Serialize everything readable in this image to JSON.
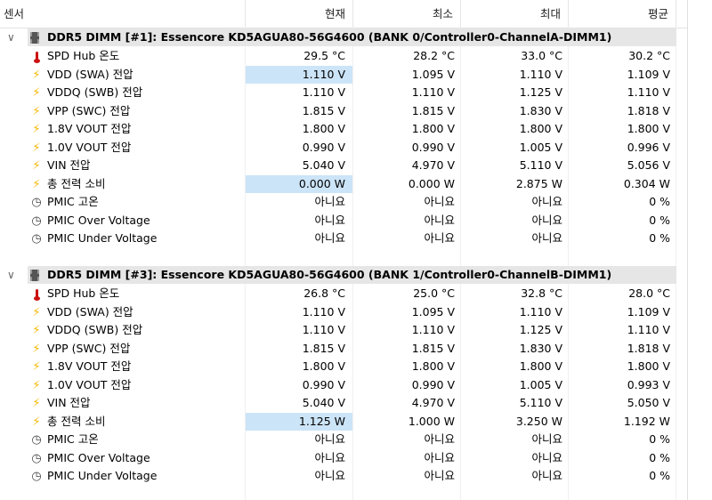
{
  "columns": {
    "sensor": "센서",
    "current": "현재",
    "min": "최소",
    "max": "최대",
    "avg": "평균"
  },
  "groups": [
    {
      "title": "DDR5 DIMM [#1]: Essencore KD5AGUA80-56G4600 (BANK 0/Controller0-ChannelA-DIMM1)",
      "rows": [
        {
          "icon": "thermometer-icon",
          "label": "SPD Hub 온도",
          "cur": "29.5 °C",
          "min": "28.2 °C",
          "max": "33.0 °C",
          "avg": "30.2 °C",
          "hl": false
        },
        {
          "icon": "lightning-icon",
          "label": "VDD (SWA) 전압",
          "cur": "1.110 V",
          "min": "1.095 V",
          "max": "1.110 V",
          "avg": "1.109 V",
          "hl": true
        },
        {
          "icon": "lightning-icon",
          "label": "VDDQ (SWB) 전압",
          "cur": "1.110 V",
          "min": "1.110 V",
          "max": "1.125 V",
          "avg": "1.110 V",
          "hl": false
        },
        {
          "icon": "lightning-icon",
          "label": "VPP (SWC) 전압",
          "cur": "1.815 V",
          "min": "1.815 V",
          "max": "1.830 V",
          "avg": "1.818 V",
          "hl": false
        },
        {
          "icon": "lightning-icon",
          "label": "1.8V VOUT 전압",
          "cur": "1.800 V",
          "min": "1.800 V",
          "max": "1.800 V",
          "avg": "1.800 V",
          "hl": false
        },
        {
          "icon": "lightning-icon",
          "label": "1.0V VOUT 전압",
          "cur": "0.990 V",
          "min": "0.990 V",
          "max": "1.005 V",
          "avg": "0.996 V",
          "hl": false
        },
        {
          "icon": "lightning-icon",
          "label": "VIN 전압",
          "cur": "5.040 V",
          "min": "4.970 V",
          "max": "5.110 V",
          "avg": "5.056 V",
          "hl": false
        },
        {
          "icon": "lightning-icon",
          "label": "총 전력 소비",
          "cur": "0.000 W",
          "min": "0.000 W",
          "max": "2.875 W",
          "avg": "0.304 W",
          "hl": true
        },
        {
          "icon": "clock-icon",
          "label": "PMIC 고온",
          "cur": "아니요",
          "min": "아니요",
          "max": "아니요",
          "avg": "0 %",
          "hl": false
        },
        {
          "icon": "clock-icon",
          "label": "PMIC Over Voltage",
          "cur": "아니요",
          "min": "아니요",
          "max": "아니요",
          "avg": "0 %",
          "hl": false
        },
        {
          "icon": "clock-icon",
          "label": "PMIC Under Voltage",
          "cur": "아니요",
          "min": "아니요",
          "max": "아니요",
          "avg": "0 %",
          "hl": false
        }
      ]
    },
    {
      "title": "DDR5 DIMM [#3]: Essencore KD5AGUA80-56G4600 (BANK 1/Controller0-ChannelB-DIMM1)",
      "rows": [
        {
          "icon": "thermometer-icon",
          "label": "SPD Hub 온도",
          "cur": "26.8 °C",
          "min": "25.0 °C",
          "max": "32.8 °C",
          "avg": "28.0 °C",
          "hl": false
        },
        {
          "icon": "lightning-icon",
          "label": "VDD (SWA) 전압",
          "cur": "1.110 V",
          "min": "1.095 V",
          "max": "1.110 V",
          "avg": "1.109 V",
          "hl": false
        },
        {
          "icon": "lightning-icon",
          "label": "VDDQ (SWB) 전압",
          "cur": "1.110 V",
          "min": "1.110 V",
          "max": "1.125 V",
          "avg": "1.110 V",
          "hl": false
        },
        {
          "icon": "lightning-icon",
          "label": "VPP (SWC) 전압",
          "cur": "1.815 V",
          "min": "1.815 V",
          "max": "1.830 V",
          "avg": "1.818 V",
          "hl": false
        },
        {
          "icon": "lightning-icon",
          "label": "1.8V VOUT 전압",
          "cur": "1.800 V",
          "min": "1.800 V",
          "max": "1.800 V",
          "avg": "1.800 V",
          "hl": false
        },
        {
          "icon": "lightning-icon",
          "label": "1.0V VOUT 전압",
          "cur": "0.990 V",
          "min": "0.990 V",
          "max": "1.005 V",
          "avg": "0.993 V",
          "hl": false
        },
        {
          "icon": "lightning-icon",
          "label": "VIN 전압",
          "cur": "5.040 V",
          "min": "4.970 V",
          "max": "5.110 V",
          "avg": "5.050 V",
          "hl": false
        },
        {
          "icon": "lightning-icon",
          "label": "총 전력 소비",
          "cur": "1.125 W",
          "min": "1.000 W",
          "max": "3.250 W",
          "avg": "1.192 W",
          "hl": true
        },
        {
          "icon": "clock-icon",
          "label": "PMIC 고온",
          "cur": "아니요",
          "min": "아니요",
          "max": "아니요",
          "avg": "0 %",
          "hl": false
        },
        {
          "icon": "clock-icon",
          "label": "PMIC Over Voltage",
          "cur": "아니요",
          "min": "아니요",
          "max": "아니요",
          "avg": "0 %",
          "hl": false
        },
        {
          "icon": "clock-icon",
          "label": "PMIC Under Voltage",
          "cur": "아니요",
          "min": "아니요",
          "max": "아니요",
          "avg": "0 %",
          "hl": false
        }
      ]
    }
  ]
}
